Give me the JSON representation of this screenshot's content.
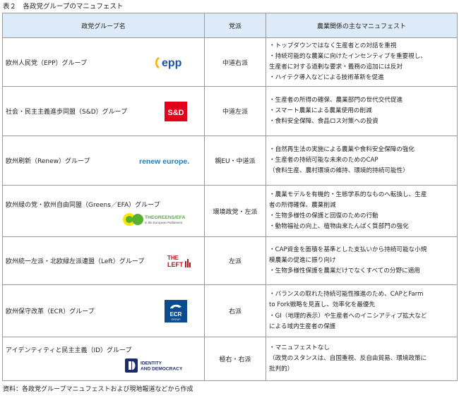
{
  "caption": "表２　各政党グループのマニュフェスト",
  "headers": [
    "政党グループ名",
    "党派",
    "農業関係の主なマニュフェスト"
  ],
  "rows": [
    {
      "name": "欧州人民党（EPP）グループ",
      "logo_text": "epp",
      "faction": "中道右派",
      "manifesto": [
        "・トップダウンではなく生産者との対話を重視",
        "・持続可能的な農業に向けたインセンティブを重要視し、",
        "生産者に対する過剰な要求・義務の追加には反対",
        "・ハイテク導入などによる技術革新を促進"
      ]
    },
    {
      "name": "社会・民主主義進歩同盟（S&D）グループ",
      "logo_text": "S&D",
      "faction": "中道左派",
      "manifesto": [
        "・生産者の所得の確保、農業部門の世代交代促進",
        "・スマート農業による農業使用の削減",
        "・食料安全保障、食品ロス対策への投資"
      ]
    },
    {
      "name": "欧州刷新（Renew）グループ",
      "logo_text": "renew europe.",
      "faction": "親EU・中道派",
      "manifesto": [
        "・自然再生法の実施による農業や食料安全保障の強化",
        "・生産者の持続可能な未来のためのCAP",
        "（食料生産、農村環境の維持、環境的持続可能性）"
      ]
    },
    {
      "name": "欧州緑の党・欧州自由同盟（Greens／EFA）グループ",
      "logo_text": [
        "THEGREENS/EFA",
        "in the European Parliament"
      ],
      "faction": "環境政党・左派",
      "manifesto": [
        "・農業モデルを有機的・生態学系的なものへ転換し、生産",
        "者の所得確保、農薬削減",
        "・生物多様性の保護と回復のための行動",
        "・動物福祉の向上、植物由来たんぱく質部門の強化"
      ]
    },
    {
      "name": "欧州統一左派・北欧緑左派連盟（Left）グループ",
      "logo_text": [
        "THE",
        "LEFT"
      ],
      "faction": "左派",
      "manifesto": [
        "・CAP資金を面積を基準とした支払いから持続可能な小規",
        "模農業の促進に振り向け",
        "・生物多様性保護を農業だけでなくすべての分野に適用"
      ]
    },
    {
      "name": "欧州保守改革（ECR）グループ",
      "logo_text": [
        "ECR",
        "GROUP"
      ],
      "faction": "右派",
      "manifesto": [
        "・バランスの取れた持続可能性推進のため、CAPとFarm",
        "to Fork戦略を見直し、効率化を最優先",
        "・GI（地理的表示）や生産者へのイニシアティブ拡大など",
        "による域内生産者の保護"
      ]
    },
    {
      "name": "アイデンティティと民主主義（ID）グループ",
      "logo_text": [
        "IDENTITY",
        "AND DEMOCRACY"
      ],
      "faction": "極右・右派",
      "manifesto": [
        "・マニュフェストなし",
        "（政党のスタンスは、自国重視、反自由貿易、環境政策に",
        "批判的）"
      ]
    }
  ],
  "source": "資料：各政党グループマニュフェストおよび現地報道などから作成",
  "colors": {
    "header_bg": "#dcebf7",
    "border": "#9a9a9a",
    "epp_blue": "#1a56a6",
    "sd_red": "#e2001a",
    "renew_blue": "#1a7fc1",
    "greens_green": "#57b031",
    "greens_yellow": "#ffe500",
    "left_red": "#b6181b",
    "ecr_blue": "#0a4c8c",
    "id_navy": "#1b2a6b"
  }
}
